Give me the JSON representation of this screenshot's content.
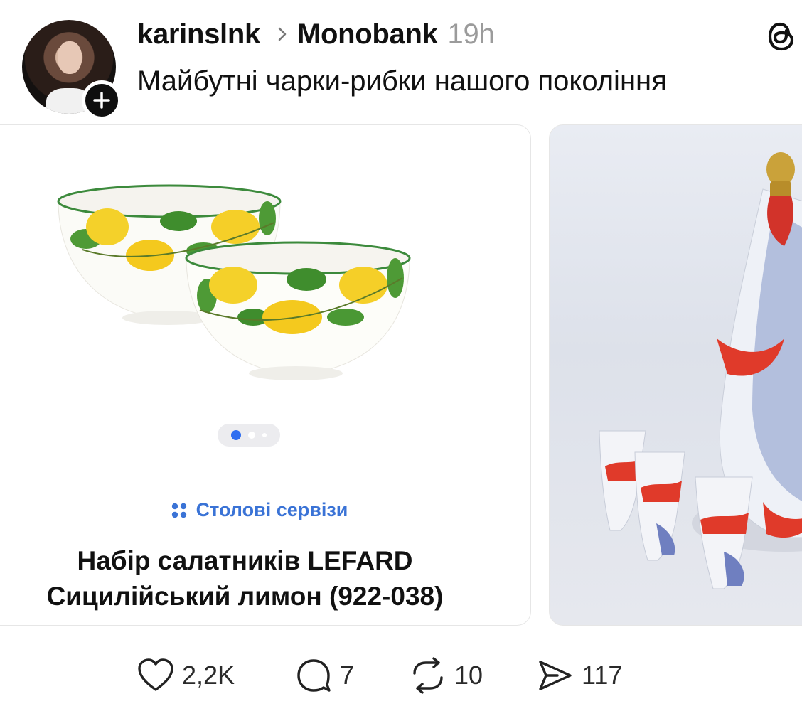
{
  "header": {
    "username": "karinslnk",
    "community": "Monobank",
    "timestamp": "19h",
    "avatar_icon": "user-avatar",
    "follow_icon": "plus-icon",
    "app_icon": "threads-icon"
  },
  "post": {
    "text": "Майбутні чарки-рибки нашого покоління"
  },
  "carousel": {
    "card1": {
      "category": "Столові сервізи",
      "category_icon": "grid-dots-icon",
      "title_line1": "Набір салатників LEFARD",
      "title_line2": "Сицилійський лимон (922-038)",
      "image_dots": 3,
      "active_dot": 1
    },
    "card2": {
      "image": "porcelain-fish-decanter-with-cups"
    }
  },
  "actions": {
    "likes": "2,2K",
    "replies": "7",
    "reposts": "10",
    "shares": "117"
  },
  "colors": {
    "accent_blue": "#3a73d6",
    "dot_active": "#2f6ef0",
    "timestamp_gray": "#9b9b9b"
  }
}
